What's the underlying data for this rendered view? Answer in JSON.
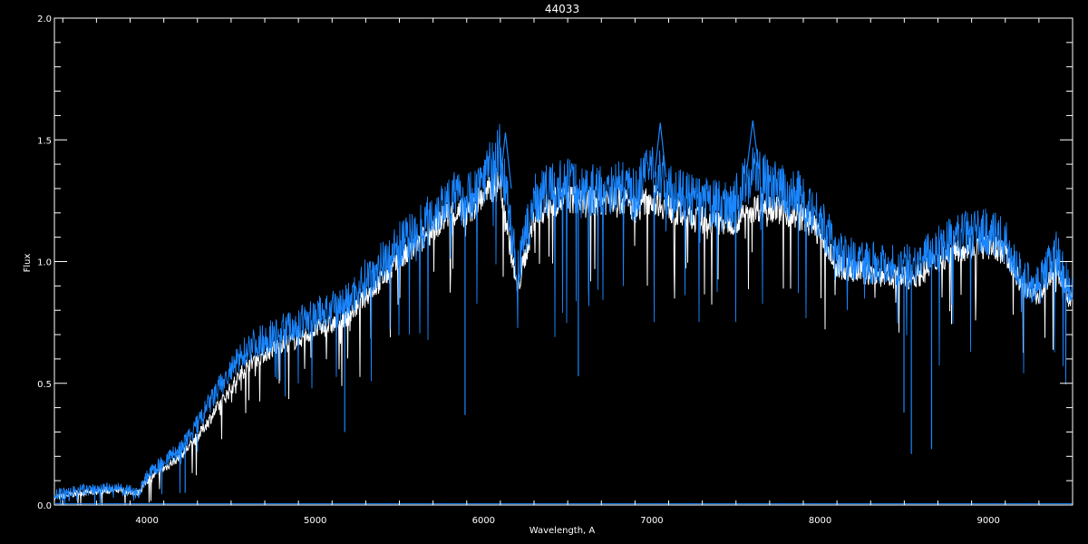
{
  "chart_data": {
    "type": "line",
    "title": "44033",
    "xlabel": "Wavelength, A",
    "ylabel": "Flux",
    "xlim": [
      3450,
      9500
    ],
    "ylim": [
      0.0,
      2.0
    ],
    "xticks": [
      4000,
      5000,
      6000,
      7000,
      8000,
      9000
    ],
    "xtick_labels": [
      "4000",
      "5000",
      "6000",
      "7000",
      "8000",
      "9000"
    ],
    "yticks": [
      0.0,
      0.5,
      1.0,
      1.5,
      2.0
    ],
    "ytick_labels": [
      "0.0",
      "0.5",
      "1.0",
      "1.5",
      "2.0"
    ],
    "grid": false,
    "background": "#000000",
    "axis_color": "#ffffff",
    "series": [
      {
        "color": "#ffffff",
        "x": [
          3450,
          3600,
          3800,
          3950,
          4000,
          4100,
          4200,
          4300,
          4400,
          4500,
          4600,
          4700,
          4800,
          4900,
          5000,
          5100,
          5200,
          5300,
          5400,
          5500,
          5600,
          5700,
          5800,
          5900,
          6000,
          6100,
          6200,
          6300,
          6400,
          6500,
          6600,
          6700,
          6800,
          6900,
          7000,
          7100,
          7200,
          7300,
          7400,
          7500,
          7600,
          7700,
          7800,
          7900,
          8000,
          8100,
          8200,
          8300,
          8400,
          8500,
          8600,
          8700,
          8800,
          8900,
          9000,
          9100,
          9200,
          9300,
          9400,
          9480
        ],
        "y": [
          0.03,
          0.05,
          0.06,
          0.05,
          0.1,
          0.15,
          0.2,
          0.28,
          0.38,
          0.48,
          0.58,
          0.62,
          0.66,
          0.68,
          0.72,
          0.74,
          0.78,
          0.86,
          0.93,
          1.0,
          1.06,
          1.14,
          1.2,
          1.2,
          1.27,
          1.32,
          0.88,
          1.18,
          1.24,
          1.26,
          1.24,
          1.25,
          1.26,
          1.22,
          1.26,
          1.22,
          1.18,
          1.17,
          1.16,
          1.17,
          1.22,
          1.23,
          1.2,
          1.18,
          1.12,
          0.98,
          0.96,
          0.95,
          0.94,
          0.93,
          0.95,
          1.0,
          1.05,
          1.06,
          1.06,
          1.04,
          0.9,
          0.86,
          0.98,
          0.85
        ]
      },
      {
        "color": "#1a86ff",
        "x": [
          3450,
          3600,
          3800,
          3950,
          4000,
          4100,
          4200,
          4300,
          4400,
          4500,
          4600,
          4700,
          4800,
          4900,
          5000,
          5100,
          5200,
          5300,
          5400,
          5500,
          5600,
          5700,
          5800,
          5900,
          6000,
          6100,
          6200,
          6300,
          6400,
          6500,
          6600,
          6700,
          6800,
          6900,
          7000,
          7100,
          7200,
          7300,
          7400,
          7500,
          7600,
          7700,
          7800,
          7900,
          8000,
          8100,
          8200,
          8300,
          8400,
          8500,
          8600,
          8700,
          8800,
          8900,
          9000,
          9100,
          9200,
          9300,
          9400,
          9480
        ],
        "y": [
          0.04,
          0.06,
          0.07,
          0.05,
          0.12,
          0.18,
          0.23,
          0.33,
          0.45,
          0.55,
          0.65,
          0.68,
          0.72,
          0.74,
          0.78,
          0.8,
          0.84,
          0.93,
          1.0,
          1.07,
          1.12,
          1.2,
          1.27,
          1.25,
          1.35,
          1.45,
          0.95,
          1.25,
          1.3,
          1.32,
          1.29,
          1.3,
          1.31,
          1.27,
          1.4,
          1.29,
          1.26,
          1.24,
          1.23,
          1.25,
          1.38,
          1.31,
          1.28,
          1.26,
          1.18,
          1.03,
          1.01,
          1.0,
          0.99,
          0.98,
          1.0,
          1.06,
          1.1,
          1.12,
          1.12,
          1.08,
          0.93,
          0.9,
          1.05,
          0.88
        ]
      }
    ],
    "absorption_lines": [
      {
        "x": 4227,
        "y": 0.05
      },
      {
        "x": 4300,
        "y": 0.22
      },
      {
        "x": 5175,
        "y": 0.3
      },
      {
        "x": 5890,
        "y": 0.37
      },
      {
        "x": 6563,
        "y": 0.53
      },
      {
        "x": 8498,
        "y": 0.38
      },
      {
        "x": 8542,
        "y": 0.21
      },
      {
        "x": 8662,
        "y": 0.23
      }
    ],
    "emission_peaks": [
      {
        "x": 6130,
        "y": 1.53
      },
      {
        "x": 7050,
        "y": 1.57
      },
      {
        "x": 7600,
        "y": 1.58
      }
    ]
  }
}
